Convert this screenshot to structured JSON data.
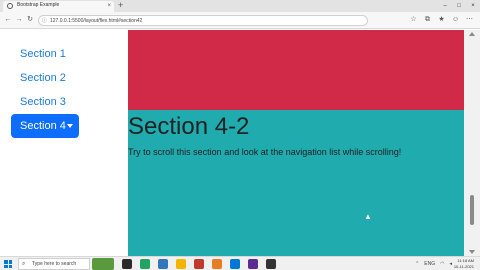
{
  "browser": {
    "tab_title": "Bootstrap Example",
    "tab_close": "×",
    "new_tab": "+",
    "window_controls": {
      "minimize": "–",
      "maximize": "□",
      "close": "×"
    },
    "url": "127.0.0.1:5500/layout/flex.html#section42",
    "nav": {
      "back": "←",
      "forward": "→",
      "reload": "↻"
    }
  },
  "sidebar": {
    "items": [
      {
        "label": "Section 1"
      },
      {
        "label": "Section 2"
      },
      {
        "label": "Section 3"
      }
    ],
    "active": {
      "label": "Section 4"
    }
  },
  "content": {
    "heading": "Section 4-2",
    "text": "Try to scroll this section and look at the navigation list while scrolling!",
    "colors": {
      "upper_section": "#d12948",
      "current_section": "#20abaf",
      "active_nav": "#0d6efd"
    }
  },
  "taskbar": {
    "search_placeholder": "Type here to search",
    "tray_lang": "ENG",
    "time": "11:18 AM",
    "date": "10-11-2021"
  }
}
